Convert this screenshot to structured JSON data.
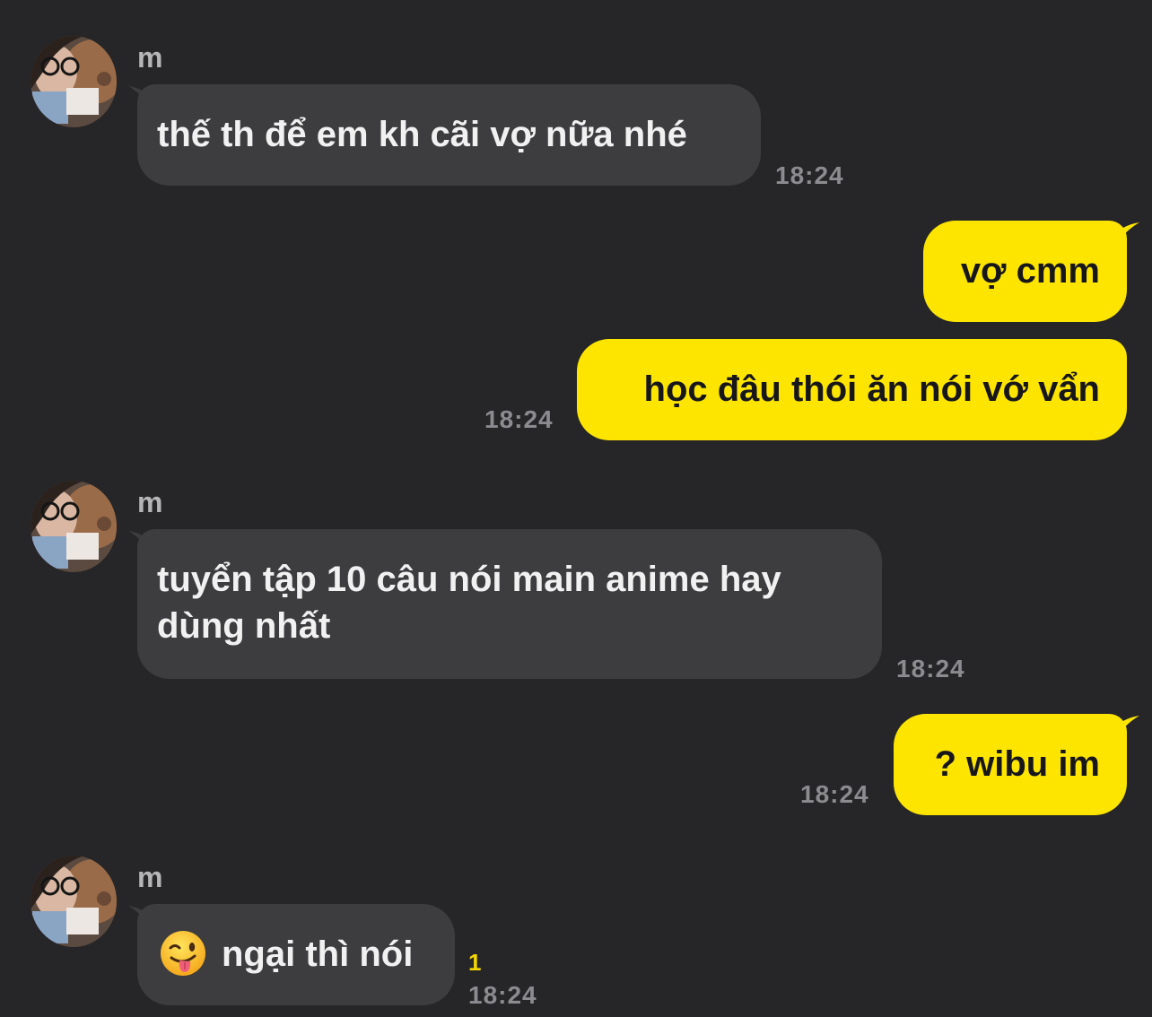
{
  "messages": [
    {
      "sender": "m",
      "text": "thế th để em kh cãi vợ nữa nhé",
      "time": "18:24"
    },
    {
      "text": "vợ cmm"
    },
    {
      "text": "học đâu thói ăn nói vớ vẩn",
      "time": "18:24"
    },
    {
      "sender": "m",
      "text": "tuyển tập 10 câu nói main anime hay dùng nhất",
      "time": "18:24"
    },
    {
      "text": "? wibu im",
      "time": "18:24"
    },
    {
      "sender": "m",
      "emoji": "winking-face-with-tongue-icon",
      "text": "ngại thì nói",
      "unread_count": "1",
      "time": "18:24"
    }
  ],
  "colors": {
    "background": "#262628",
    "incoming_bubble": "#3d3d40",
    "outgoing_bubble": "#fee500",
    "unread": "#f2d400"
  }
}
